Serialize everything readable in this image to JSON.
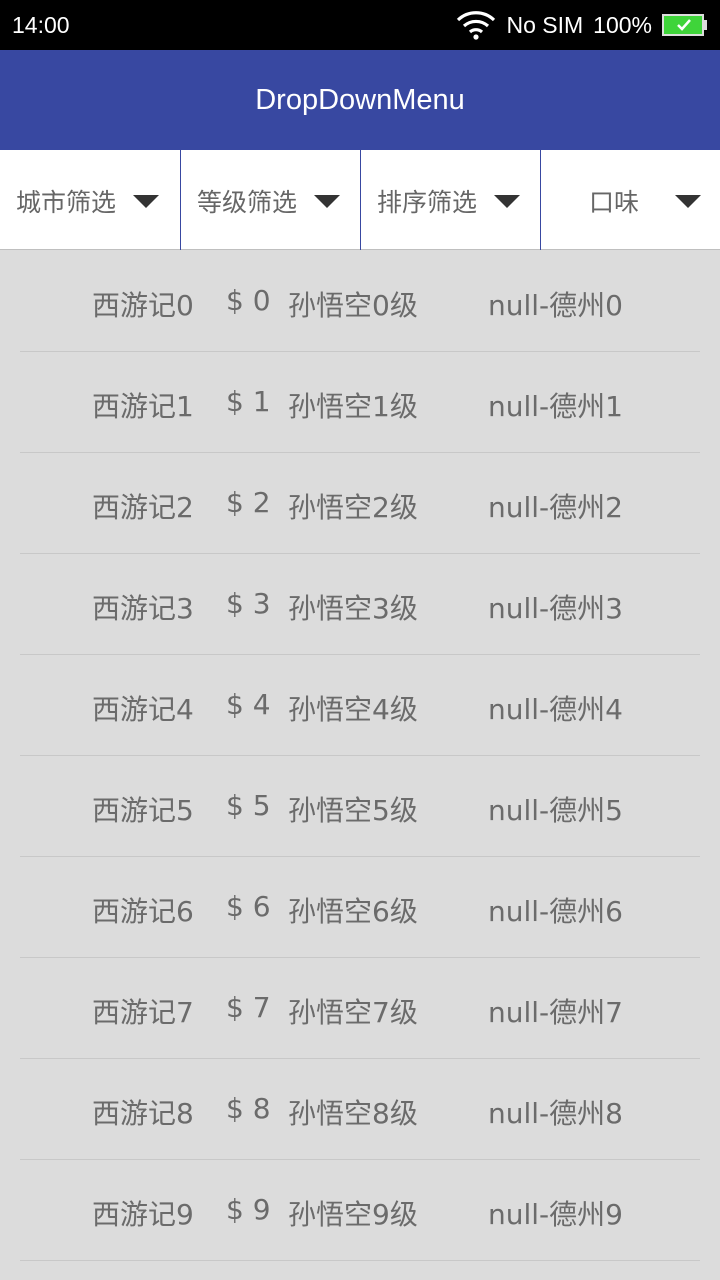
{
  "status_bar": {
    "time": "14:00",
    "carrier": "No SIM",
    "battery": "100%",
    "icons": [
      "wifi-icon",
      "battery-icon"
    ]
  },
  "app_bar": {
    "title": "DropDownMenu",
    "color": "#3848a1"
  },
  "filters": [
    {
      "label": "城市筛选"
    },
    {
      "label": "等级筛选"
    },
    {
      "label": "排序筛选"
    },
    {
      "label": "口味"
    }
  ],
  "items": [
    {
      "title": "西游记0",
      "price": "$ 0",
      "hero": "孙悟空0级",
      "city": "null-德州0"
    },
    {
      "title": "西游记1",
      "price": "$ 1",
      "hero": "孙悟空1级",
      "city": "null-德州1"
    },
    {
      "title": "西游记2",
      "price": "$ 2",
      "hero": "孙悟空2级",
      "city": "null-德州2"
    },
    {
      "title": "西游记3",
      "price": "$ 3",
      "hero": "孙悟空3级",
      "city": "null-德州3"
    },
    {
      "title": "西游记4",
      "price": "$ 4",
      "hero": "孙悟空4级",
      "city": "null-德州4"
    },
    {
      "title": "西游记5",
      "price": "$ 5",
      "hero": "孙悟空5级",
      "city": "null-德州5"
    },
    {
      "title": "西游记6",
      "price": "$ 6",
      "hero": "孙悟空6级",
      "city": "null-德州6"
    },
    {
      "title": "西游记7",
      "price": "$ 7",
      "hero": "孙悟空7级",
      "city": "null-德州7"
    },
    {
      "title": "西游记8",
      "price": "$ 8",
      "hero": "孙悟空8级",
      "city": "null-德州8"
    },
    {
      "title": "西游记9",
      "price": "$ 9",
      "hero": "孙悟空9级",
      "city": "null-德州9"
    }
  ]
}
